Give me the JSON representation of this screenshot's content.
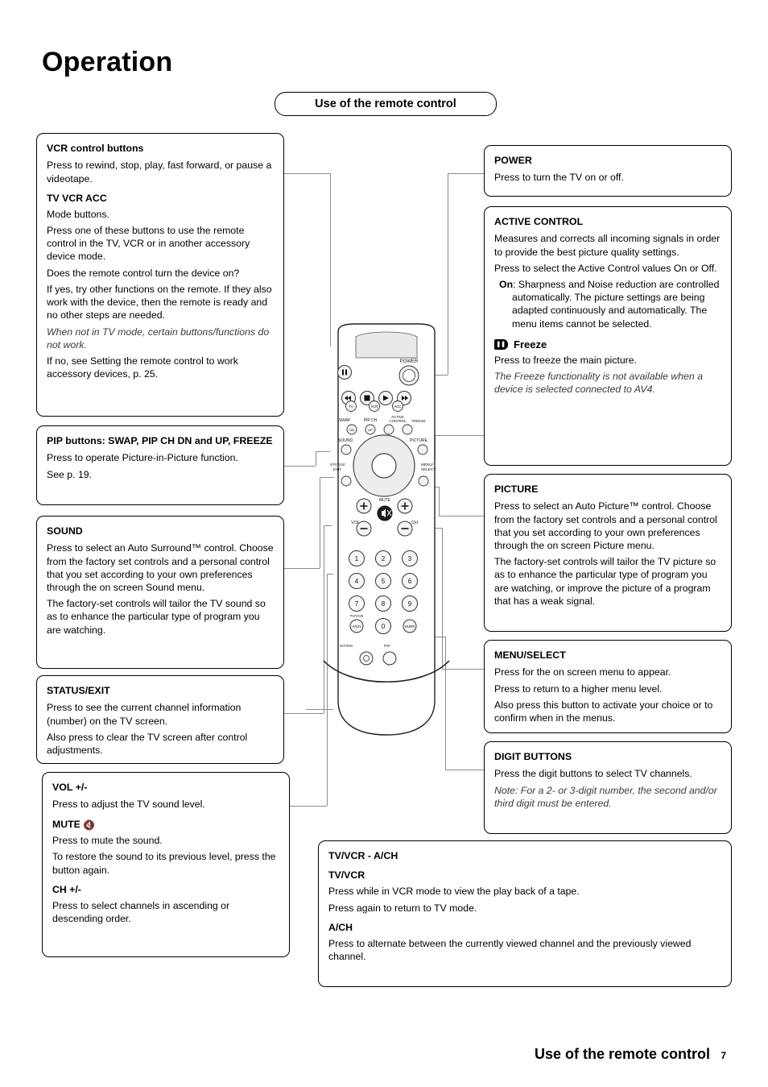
{
  "header": {
    "title": "Operation",
    "pill_label": "Use of the remote control"
  },
  "footer": {
    "title": "Use of the remote control",
    "page_number": "7"
  },
  "left_boxes": [
    {
      "heading": "VCR control buttons",
      "paras": [
        "Press to rewind, stop, play, fast forward, or pause a videotape."
      ],
      "sub_heading": "TV  VCR  ACC",
      "sub_paras": [
        "Mode buttons.",
        "Press one of these buttons to use the remote control in the TV, VCR or in another accessory device mode.",
        "Does the remote control turn the device on?",
        "If yes, try other functions on the remote. If they also work with the device, then the remote is ready and no other steps are needed."
      ],
      "italic": "When not in TV mode, certain buttons/functions do not work.",
      "tail": "If no,  see Setting the remote control to work accessory devices, p. 25."
    },
    {
      "heading": "PIP buttons: SWAP, PIP CH DN and UP, FREEZE",
      "paras": [
        "Press to operate Picture-in-Picture function.",
        "See p. 19."
      ]
    },
    {
      "heading": "SOUND",
      "paras": [
        "Press to select an Auto Surround™ control. Choose from the factory set controls and a personal control that you set according to your own preferences through the on screen Sound menu.",
        "The factory-set controls will tailor the TV sound so as to enhance the particular type of program you are watching."
      ]
    },
    {
      "heading": "STATUS/EXIT",
      "paras": [
        "Press to see the current channel information (number) on the TV screen.",
        "Also press to clear the TV screen after control adjustments."
      ]
    },
    {
      "heading": "VOL +/-",
      "paras": [
        "Press to adjust the TV sound level."
      ],
      "sub_heading": "MUTE",
      "sub_icon": "mute-icon",
      "sub_paras": [
        "Press to mute the sound.",
        "To restore the sound to its previous level, press the button again."
      ],
      "sub_heading2": "CH +/-",
      "sub_paras2": [
        "Press to select channels in ascending or descending order."
      ]
    }
  ],
  "right_boxes": [
    {
      "heading": "POWER",
      "paras": [
        "Press to turn the TV on or off."
      ]
    },
    {
      "heading": "ACTIVE CONTROL",
      "paras": [
        "Measures and corrects all incoming signals in order to provide the best picture quality settings.",
        "Press to select the Active Control values On or Off."
      ],
      "on_label": "On",
      "on_text": ": Sharpness and Noise reduction are controlled automatically. The picture settings are being adapted continuously and automatically. The menu items cannot be selected.",
      "freeze_label": "Freeze",
      "freeze_paras": [
        "Press to freeze the main picture."
      ],
      "freeze_italic": "The Freeze functionality is not available when a device is selected connected to AV4."
    },
    {
      "heading": "PICTURE",
      "paras": [
        "Press to select an Auto Picture™ control. Choose from the factory set controls and a personal control that you set according to your own preferences through the on screen Picture menu.",
        "The factory-set controls will tailor the TV picture so as to enhance the particular type of program you are watching, or improve the picture of a program that has a weak signal."
      ]
    },
    {
      "heading": "MENU/SELECT",
      "paras": [
        "Press for the on screen menu to appear.",
        "Press to return to a higher menu level.",
        "Also press this button to activate your choice or to confirm when in the menus."
      ]
    },
    {
      "heading": "DIGIT BUTTONS",
      "paras": [
        "Press the digit buttons to select TV channels."
      ],
      "italic": "Note: For a 2- or 3-digit number, the second and/or third digit must be entered."
    }
  ],
  "bottom_box": {
    "heading": "TV/VCR - A/CH",
    "sub_heading": "TV/VCR",
    "sub_paras": [
      "Press while in VCR mode to view the play back of a tape.",
      "Press again to return to TV mode."
    ],
    "sub_heading2": "A/CH",
    "sub_paras2": [
      "Press to alternate between the currently viewed channel and the previously viewed channel."
    ]
  },
  "remote_labels": {
    "power": "POWER",
    "swap": "SWAP",
    "pip_ch": "PIP CH",
    "active_control": "ACTIVE CONTROL",
    "freeze": "FREEZE",
    "sound": "SOUND",
    "picture": "PICTURE",
    "status_exit": "STATUS/ EXIT",
    "menu_select": "MENU/ SELECT",
    "vol": "VOL",
    "mute": "MUTE",
    "ch": "CH",
    "tv": "TV",
    "vcr": "VCR",
    "acc": "ACC",
    "dn": "DN",
    "up": "UP",
    "tv_vcr": "TV/VCR",
    "ach": "A/CH",
    "surf": "SURF",
    "position": "SITION",
    "pip": "PIP",
    "digits": [
      "1",
      "2",
      "3",
      "4",
      "5",
      "6",
      "7",
      "8",
      "9",
      "0"
    ]
  }
}
